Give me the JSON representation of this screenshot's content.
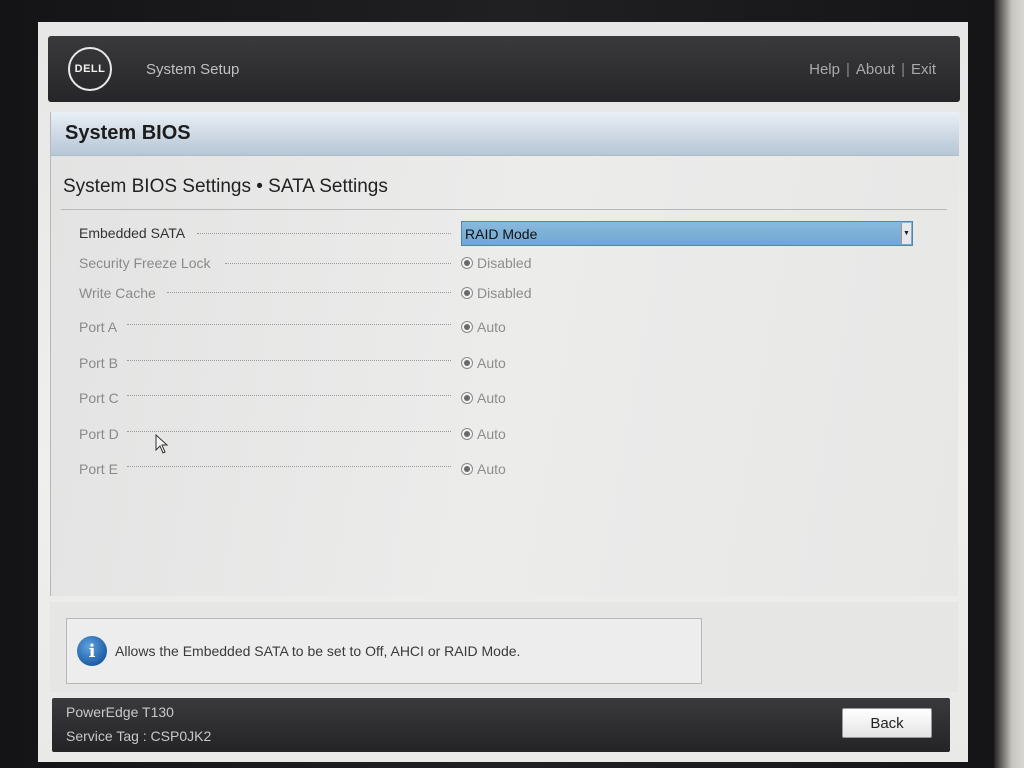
{
  "header": {
    "logo_text": "DELL",
    "app_title": "System Setup",
    "links": [
      "Help",
      "About",
      "Exit"
    ]
  },
  "panel": {
    "title": "System BIOS",
    "subtitle": "System BIOS Settings • SATA Settings"
  },
  "settings": [
    {
      "label": "Embedded SATA",
      "type": "select",
      "value": "RAID Mode"
    },
    {
      "label": "Security Freeze Lock",
      "type": "radio",
      "value": "Disabled"
    },
    {
      "label": "Write Cache",
      "type": "radio",
      "value": "Disabled"
    },
    {
      "label": "Port A",
      "type": "radio",
      "value": "Auto"
    },
    {
      "label": "Port B",
      "type": "radio",
      "value": "Auto"
    },
    {
      "label": "Port C",
      "type": "radio",
      "value": "Auto"
    },
    {
      "label": "Port D",
      "type": "radio",
      "value": "Auto"
    },
    {
      "label": "Port E",
      "type": "radio",
      "value": "Auto"
    }
  ],
  "help": {
    "icon": "info-icon",
    "text": "Allows the Embedded SATA to be set to Off, AHCI or RAID Mode."
  },
  "footer": {
    "model": "PowerEdge T130",
    "service_tag": "Service Tag : CSP0JK2",
    "back_label": "Back"
  },
  "colors": {
    "select_highlight": "#7fb2d9",
    "header_bg": "#2e2e30",
    "info_icon": "#1f5fa8"
  }
}
